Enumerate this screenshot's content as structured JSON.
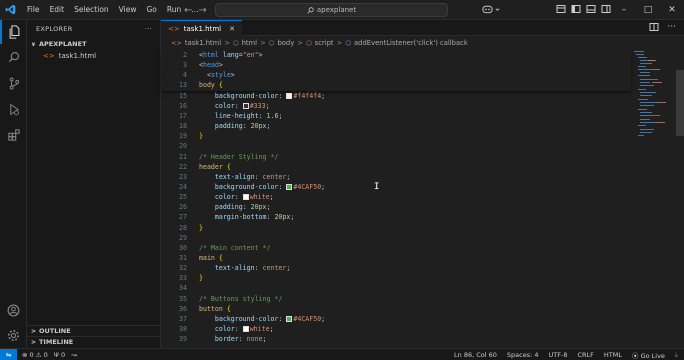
{
  "titlebar": {
    "menu": [
      "File",
      "Edit",
      "Selection",
      "View",
      "Go",
      "Run",
      "…"
    ],
    "search_text": "apexplanet",
    "window_controls": [
      "–",
      "□",
      "✕"
    ]
  },
  "sidebar": {
    "title": "EXPLORER",
    "more": "···",
    "folder": "APEXPLANET",
    "files": [
      "task1.html"
    ],
    "sections": [
      "OUTLINE",
      "TIMELINE"
    ]
  },
  "editor": {
    "tab_label": "task1.html",
    "breadcrumb": [
      "task1.html",
      "html",
      "body",
      "script",
      "addEventListener('click') callback"
    ],
    "lines": [
      {
        "n": "2",
        "html": "<span class='t-punc'>&lt;</span><span class='t-tag'>html</span> <span class='t-attr'>lang</span><span class='t-punc'>=</span><span class='t-str'>\"en\"</span><span class='t-punc'>&gt;</span>",
        "sticky": true
      },
      {
        "n": "3",
        "html": "<span class='t-punc'>&lt;</span><span class='t-tag'>head</span><span class='t-punc'>&gt;</span>",
        "sticky": true
      },
      {
        "n": "4",
        "html": "  <span class='t-punc'>&lt;</span><span class='t-tag'>style</span><span class='t-punc'>&gt;</span>",
        "sticky": true
      },
      {
        "n": "13",
        "html": "<span class='t-sel'>body</span> <span class='t-brace'>{</span>",
        "sticky": true
      },
      {
        "n": "15",
        "html": "    <span class='t-prop'>background-color</span>: <span class='swatch' style='background:#f4f4f4'></span><span class='t-val'>#f4f4f4</span>;"
      },
      {
        "n": "16",
        "html": "    <span class='t-prop'>color</span>: <span class='swatch' style='background:#333333'></span><span class='t-val'>#333</span>;"
      },
      {
        "n": "17",
        "html": "    <span class='t-prop'>line-height</span>: <span class='t-num'>1.6</span>;"
      },
      {
        "n": "18",
        "html": "    <span class='t-prop'>padding</span>: <span class='t-num'>20px</span>;"
      },
      {
        "n": "19",
        "html": "<span class='t-brace'>}</span>"
      },
      {
        "n": "20",
        "html": ""
      },
      {
        "n": "21",
        "html": "<span class='t-com'>/* Header Styling */</span>"
      },
      {
        "n": "22",
        "html": "<span class='t-sel'>header</span> <span class='t-brace'>{</span>"
      },
      {
        "n": "23",
        "html": "    <span class='t-prop'>text-align</span>: <span class='t-val'>center</span>;"
      },
      {
        "n": "24",
        "html": "    <span class='t-prop'>background-color</span>: <span class='swatch' style='background:#4CAF50'></span><span class='t-val'>#4CAF50</span>;"
      },
      {
        "n": "25",
        "html": "    <span class='t-prop'>color</span>: <span class='swatch' style='background:#ffffff'></span><span class='t-val'>white</span>;"
      },
      {
        "n": "26",
        "html": "    <span class='t-prop'>padding</span>: <span class='t-num'>20px</span>;"
      },
      {
        "n": "27",
        "html": "    <span class='t-prop'>margin-bottom</span>: <span class='t-num'>20px</span>;"
      },
      {
        "n": "28",
        "html": "<span class='t-brace'>}</span>"
      },
      {
        "n": "29",
        "html": ""
      },
      {
        "n": "30",
        "html": "<span class='t-com'>/* Main content */</span>"
      },
      {
        "n": "31",
        "html": "<span class='t-sel'>main</span> <span class='t-brace'>{</span>"
      },
      {
        "n": "32",
        "html": "    <span class='t-prop'>text-align</span>: <span class='t-val'>center</span>;"
      },
      {
        "n": "33",
        "html": "<span class='t-brace'>}</span>"
      },
      {
        "n": "34",
        "html": ""
      },
      {
        "n": "35",
        "html": "<span class='t-com'>/* Buttons styling */</span>"
      },
      {
        "n": "36",
        "html": "<span class='t-sel'>button</span> <span class='t-brace'>{</span>"
      },
      {
        "n": "37",
        "html": "    <span class='t-prop'>background-color</span>: <span class='swatch' style='background:#4CAF50'></span><span class='t-val'>#4CAF50</span>;"
      },
      {
        "n": "38",
        "html": "    <span class='t-prop'>color</span>: <span class='swatch' style='background:#ffffff'></span><span class='t-val'>white</span>;"
      },
      {
        "n": "39",
        "html": "    <span class='t-prop'>border</span>: <span class='t-val'>none</span>;"
      }
    ]
  },
  "statusbar": {
    "errors": "0",
    "warnings": "0",
    "ports": "0",
    "position": "Ln 86, Col 60",
    "spaces": "Spaces: 4",
    "encoding": "UTF-8",
    "eol": "CRLF",
    "language": "HTML",
    "golive": "Go Live"
  },
  "colors": {
    "accent": "#0078d4",
    "file_icon": "#e37933"
  }
}
